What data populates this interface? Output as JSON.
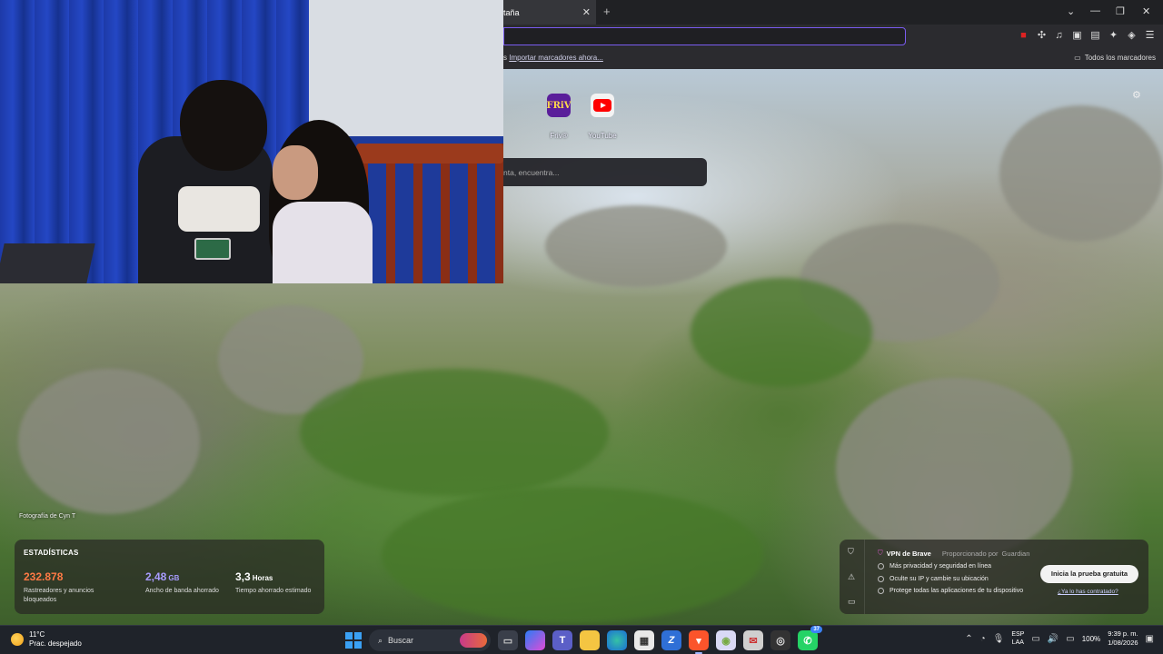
{
  "browser": {
    "tab_title": "taña",
    "tab_close": "✕",
    "new_tab": "+",
    "bookmarks_import_link": "Importar marcadores ahora...",
    "bookmarks_prefix": "s",
    "bookmarks_all": "Todos los marcadores",
    "accent": "#7a5cf0"
  },
  "top_sites": [
    {
      "label": "Friv®",
      "icon": "friv-icon",
      "tile_text": "FRiV"
    },
    {
      "label": "YouTube",
      "icon": "youtube-icon"
    }
  ],
  "search": {
    "placeholder": "nta, encuentra..."
  },
  "photo_credit": "Fotografía de Cyn T",
  "stats": {
    "title": "ESTADÍSTICAS",
    "trackers": {
      "value": "232.878",
      "desc": "Rastreadores y anuncios bloqueados",
      "color": "#ff7a45"
    },
    "bandwidth": {
      "value": "2,48",
      "unit": "GB",
      "desc": "Ancho de banda ahorrado",
      "color": "#a89cff"
    },
    "time": {
      "value": "3,3",
      "unit": "Horas",
      "desc": "Tiempo ahorrado estimado"
    }
  },
  "vpn": {
    "name": "VPN de Brave",
    "powered": "Proporcionado por",
    "provider": "Guardian",
    "items": [
      "Más privacidad y seguridad en línea",
      "Oculte su IP y cambie su ubicación",
      "Protege todas las aplicaciones de tu dispositivo"
    ],
    "cta": "Inicia la prueba gratuita",
    "link": "¿Ya lo has contratado?"
  },
  "taskbar": {
    "temp": "11°C",
    "weather": "Prac. despejado",
    "search_label": "Buscar",
    "lang_top": "ESP",
    "lang_bottom": "LAA",
    "battery": "100%",
    "time": "9:39 p. m.",
    "date": "1/08/2026",
    "whatsapp_badge": "37"
  }
}
